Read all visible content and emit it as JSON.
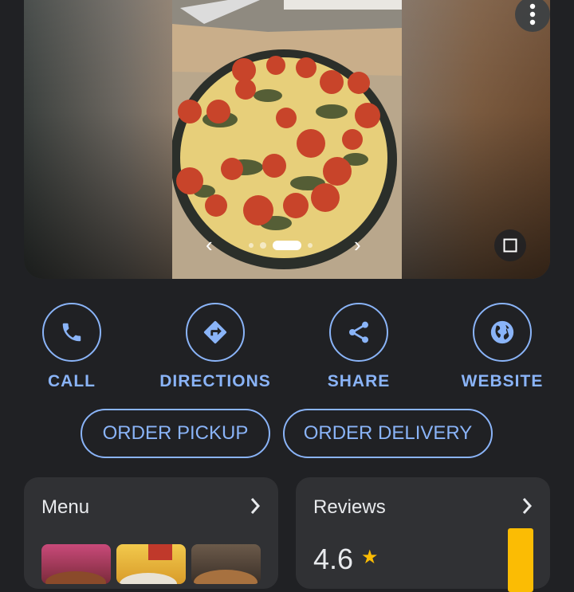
{
  "carousel": {
    "prev_icon": "chevron-left-icon",
    "next_icon": "chevron-right-icon",
    "prev_glyph": "‹",
    "next_glyph": "›",
    "dot_count": 5,
    "active_dot": 2
  },
  "actions": [
    {
      "label": "CALL",
      "icon": "phone-icon"
    },
    {
      "label": "DIRECTIONS",
      "icon": "directions-icon"
    },
    {
      "label": "SHARE",
      "icon": "share-icon"
    },
    {
      "label": "WEBSITE",
      "icon": "globe-icon"
    }
  ],
  "order": {
    "pickup_label": "ORDER PICKUP",
    "delivery_label": "ORDER DELIVERY"
  },
  "menu_card": {
    "title": "Menu"
  },
  "reviews_card": {
    "title": "Reviews",
    "rating": "4.6",
    "star": "★"
  },
  "colors": {
    "accent": "#8ab4f8",
    "background": "#202124",
    "card": "#303134",
    "star": "#fbbc04"
  }
}
